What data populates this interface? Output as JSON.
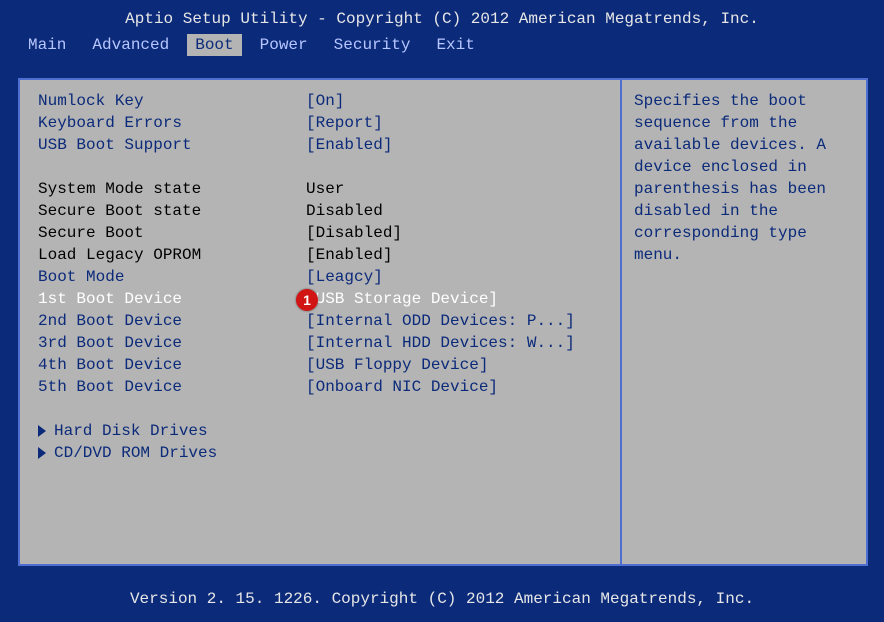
{
  "title": "Aptio Setup Utility - Copyright (C) 2012 American Megatrends, Inc.",
  "footer": "Version 2. 15. 1226. Copyright (C) 2012 American Megatrends, Inc.",
  "tabs": [
    "Main",
    "Advanced",
    "Boot",
    "Power",
    "Security",
    "Exit"
  ],
  "active_tab": "Boot",
  "settings": [
    {
      "label": "Numlock Key",
      "value": "[On]",
      "style": "blue",
      "interactive": true,
      "name": "setting-numlock-key"
    },
    {
      "label": "Keyboard Errors",
      "value": "[Report]",
      "style": "blue",
      "interactive": true,
      "name": "setting-keyboard-errors"
    },
    {
      "label": "USB Boot Support",
      "value": "[Enabled]",
      "style": "blue",
      "interactive": true,
      "name": "setting-usb-boot-support"
    },
    {
      "label": "",
      "value": "",
      "style": "blue",
      "interactive": false,
      "name": "spacer"
    },
    {
      "label": "System Mode state",
      "value": "User",
      "style": "black",
      "interactive": false,
      "name": "info-system-mode-state"
    },
    {
      "label": "Secure Boot state",
      "value": "Disabled",
      "style": "black",
      "interactive": false,
      "name": "info-secure-boot-state"
    },
    {
      "label": "Secure Boot",
      "value": "[Disabled]",
      "style": "black",
      "interactive": false,
      "name": "info-secure-boot"
    },
    {
      "label": "Load Legacy OPROM",
      "value": "[Enabled]",
      "style": "black",
      "interactive": false,
      "name": "info-load-legacy-oprom"
    },
    {
      "label": "Boot Mode",
      "value": "[Leagcy]",
      "style": "blue",
      "interactive": true,
      "name": "setting-boot-mode"
    },
    {
      "label": "1st Boot Device",
      "value": "[USB Storage Device]",
      "style": "white",
      "interactive": true,
      "name": "setting-1st-boot-device",
      "selected": true
    },
    {
      "label": "2nd Boot Device",
      "value": "[Internal ODD Devices: P...]",
      "style": "blue",
      "interactive": true,
      "name": "setting-2nd-boot-device"
    },
    {
      "label": "3rd Boot Device",
      "value": "[Internal HDD Devices: W...]",
      "style": "blue",
      "interactive": true,
      "name": "setting-3rd-boot-device"
    },
    {
      "label": "4th Boot Device",
      "value": "[USB Floppy Device]",
      "style": "blue",
      "interactive": true,
      "name": "setting-4th-boot-device"
    },
    {
      "label": "5th Boot Device",
      "value": "[Onboard NIC Device]",
      "style": "blue",
      "interactive": true,
      "name": "setting-5th-boot-device"
    }
  ],
  "submenus": [
    {
      "label": "Hard Disk Drives",
      "name": "submenu-hard-disk-drives"
    },
    {
      "label": "CD/DVD ROM Drives",
      "name": "submenu-cd-dvd-rom-drives"
    }
  ],
  "help_text": "Specifies the boot sequence from the available devices. A device enclosed in parenthesis has been disabled in the corresponding type menu.",
  "marker": {
    "label": "1"
  }
}
